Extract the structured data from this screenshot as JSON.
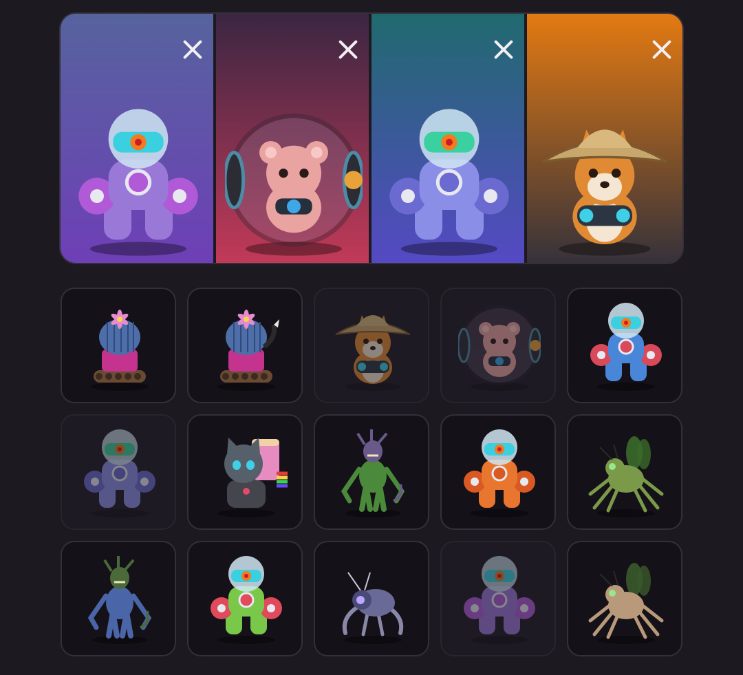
{
  "selected": [
    {
      "character": "purple-astro-robot",
      "bg_top": "#56639e",
      "bg_bottom": "#6e3fb6",
      "remove_icon": "close-icon"
    },
    {
      "character": "hamster-in-ball",
      "bg_top": "#3b2642",
      "bg_bottom": "#c13a58",
      "remove_icon": "close-icon"
    },
    {
      "character": "blue-astro-robot",
      "bg_top": "#206a6e",
      "bg_bottom": "#5549c4",
      "remove_icon": "close-icon"
    },
    {
      "character": "shiba-straw-hat",
      "bg_top": "#e37a12",
      "bg_bottom": "#36323a",
      "remove_icon": "close-icon"
    }
  ],
  "collection": [
    {
      "character": "cactus-tank",
      "state": "available"
    },
    {
      "character": "cactus-tank-tail",
      "state": "available"
    },
    {
      "character": "shiba-straw-hat",
      "state": "selected"
    },
    {
      "character": "hamster-in-ball",
      "state": "selected"
    },
    {
      "character": "blue-astro-robot-red",
      "state": "available"
    },
    {
      "character": "blue-astro-robot",
      "state": "selected"
    },
    {
      "character": "robot-cat-rainbow",
      "state": "available"
    },
    {
      "character": "green-alien-warrior",
      "state": "available"
    },
    {
      "character": "orange-astro-robot",
      "state": "available"
    },
    {
      "character": "green-bug-spider",
      "state": "available"
    },
    {
      "character": "blue-alien-warrior",
      "state": "available"
    },
    {
      "character": "green-astro-robot",
      "state": "available"
    },
    {
      "character": "purple-robo-mite",
      "state": "available"
    },
    {
      "character": "purple-astro-robot",
      "state": "selected"
    },
    {
      "character": "tan-bug-spider",
      "state": "available"
    }
  ]
}
